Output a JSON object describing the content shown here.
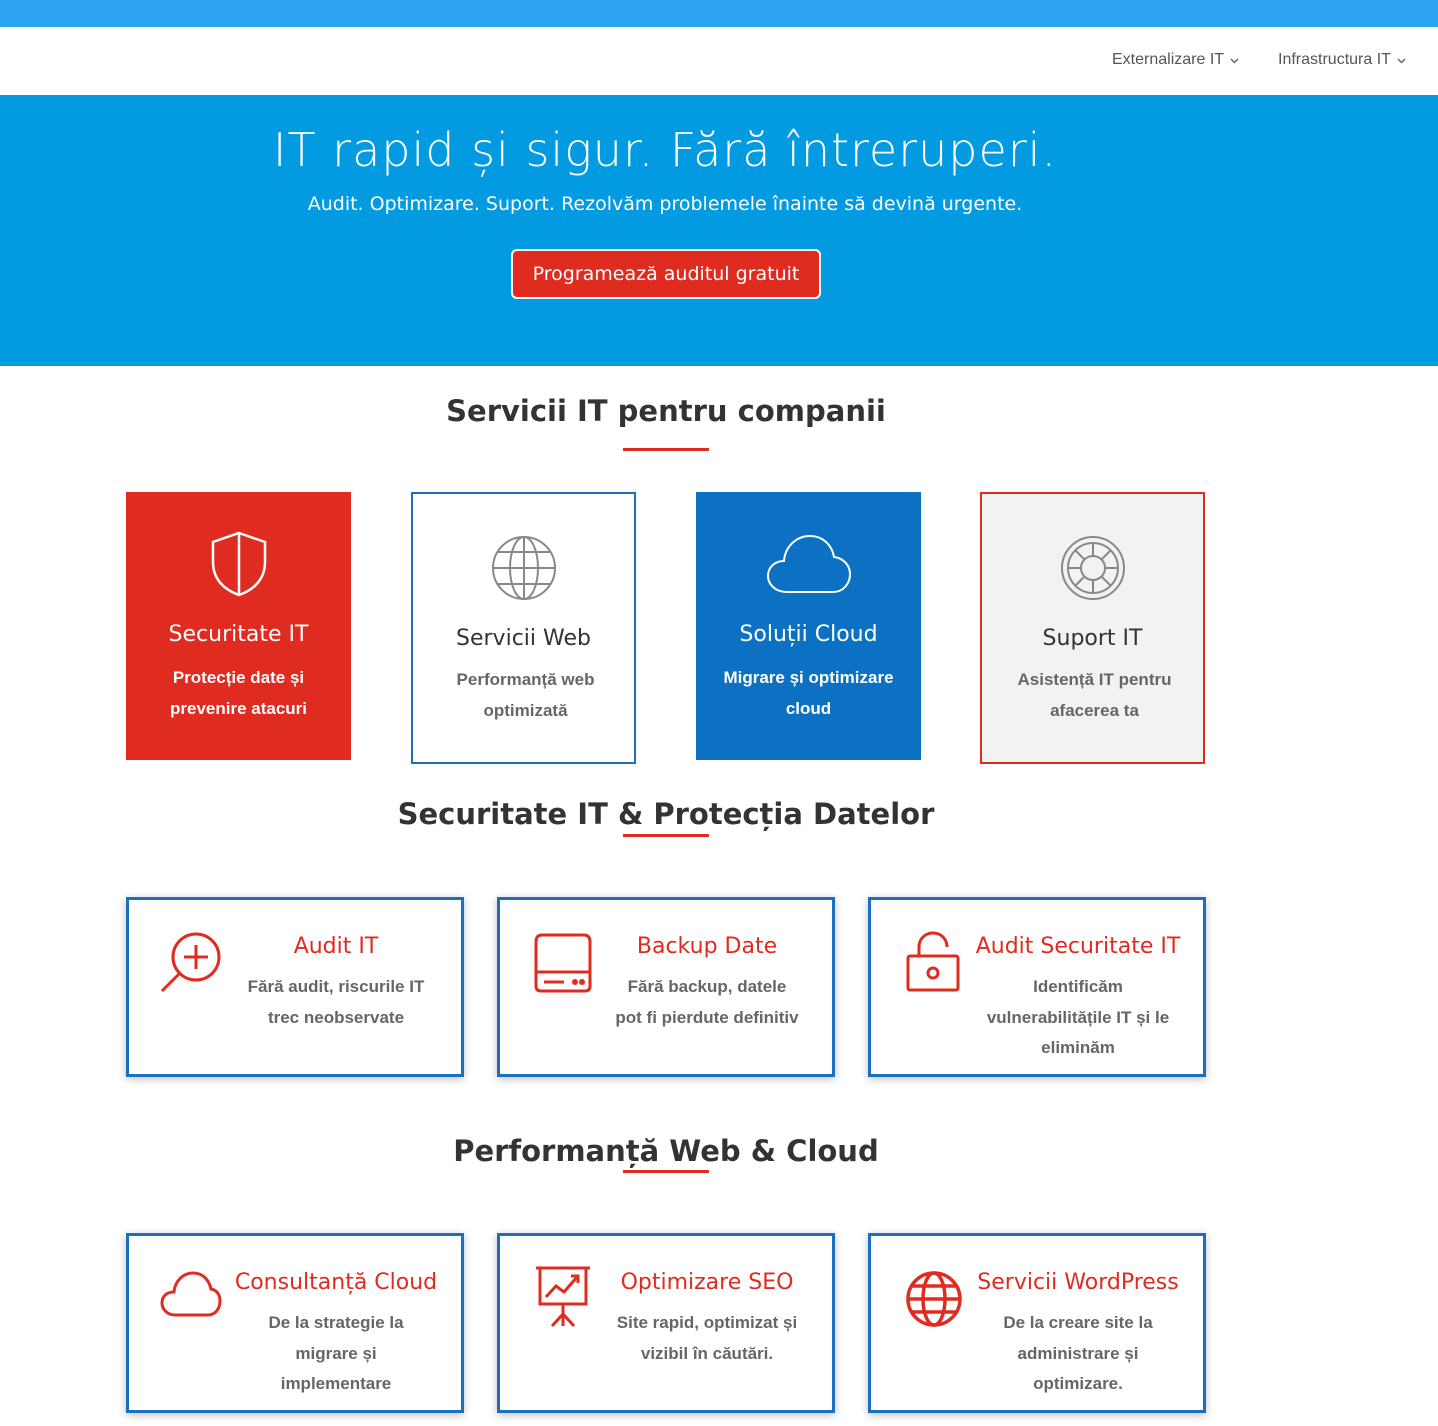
{
  "nav": {
    "items": [
      {
        "label": "Externalizare IT",
        "chevron": "⌄"
      },
      {
        "label": "Infrastructura IT",
        "chevron": "⌄"
      }
    ]
  },
  "hero": {
    "title": "IT rapid și sigur. Fără întreruperi.",
    "subtitle": "Audit. Optimizare. Suport. Rezolvăm problemele înainte să devină urgente.",
    "cta_label": "Programează auditul gratuit"
  },
  "services": {
    "title": "Servicii IT pentru companii",
    "items": [
      {
        "title": "Securitate IT",
        "desc": "Protecție date și prevenire atacuri",
        "icon": "shield-icon",
        "bg": "#e02b20"
      },
      {
        "title": "Servicii Web",
        "desc": "Performanță web optimizată",
        "icon": "globe-icon",
        "bg": "#ffffff"
      },
      {
        "title": "Soluții Cloud",
        "desc": "Migrare și optimizare cloud",
        "icon": "cloud-icon",
        "bg": "#0c71c3"
      },
      {
        "title": "Suport IT",
        "desc": "Asistență IT pentru afacerea ta",
        "icon": "lifebuoy-icon",
        "bg": "#f2f2f2"
      }
    ]
  },
  "security": {
    "title": "Securitate IT & Protecția Datelor",
    "cards": [
      {
        "title": "Audit IT",
        "desc": "Fără audit, riscurile IT trec neobservate",
        "icon": "zoom-in-icon"
      },
      {
        "title": "Backup Date",
        "desc": "Fără backup, datele pot fi pierdute definitiv",
        "icon": "hard-drive-icon"
      },
      {
        "title": "Audit Securitate IT",
        "desc": "Identificăm vulnerabilitățile IT și le eliminăm",
        "icon": "unlock-icon"
      }
    ]
  },
  "performance": {
    "title": "Performanță Web & Cloud",
    "cards": [
      {
        "title": "Consultanță Cloud",
        "desc": "De la strategie la migrare și implementare",
        "icon": "cloud-icon"
      },
      {
        "title": "Optimizare SEO",
        "desc": "Site rapid, optimizat și vizibil în căutări.",
        "icon": "presentation-chart-icon"
      },
      {
        "title": "Servicii WordPress",
        "desc": "De la creare site la administrare și optimizare.",
        "icon": "globe-icon"
      }
    ]
  },
  "colors": {
    "accent_red": "#e02b20",
    "hero_blue": "#029be2",
    "top_bar_blue": "#2ea3f2",
    "card_border_blue": "#1a6fbf",
    "cloud_tile_blue": "#0c71c3"
  }
}
